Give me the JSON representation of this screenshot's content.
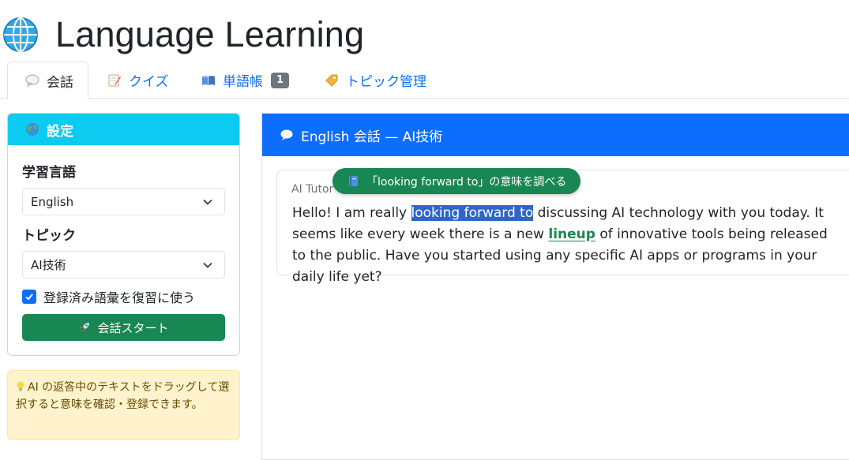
{
  "app": {
    "title": "Language Learning",
    "icon": "globe-icon"
  },
  "tabs": [
    {
      "label": "会話",
      "icon": "speech-bubble-icon",
      "active": true
    },
    {
      "label": "クイズ",
      "icon": "memo-icon",
      "active": false
    },
    {
      "label": "単語帳",
      "icon": "open-book-icon",
      "active": false,
      "badge": "1"
    },
    {
      "label": "トピック管理",
      "icon": "tag-icon",
      "active": false
    }
  ],
  "settings": {
    "header": "設定",
    "language_label": "学習言語",
    "language_value": "English",
    "topic_label": "トピック",
    "topic_value": "AI技術",
    "review_checkbox_label": "登録済み語彙を復習に使う",
    "review_checked": true,
    "start_button": "会話スタート"
  },
  "hint": {
    "text": "AI の返答中のテキストをドラッグして選択すると意味を確認・登録できます。"
  },
  "conversation": {
    "header": "English 会話 — AI技術",
    "message": {
      "sender": "AI Tutor",
      "text_before": "Hello! I am really ",
      "selected": "looking forward to",
      "text_middle": " discussing AI technology with you today. It seems like every week there is a new ",
      "vocab": "lineup",
      "text_after": " of innovative tools being released to the public. Have you started using any specific AI apps or programs in your daily life yet?"
    },
    "lookup_tooltip": "「looking forward to」の意味を調べる"
  },
  "colors": {
    "primary": "#0d6efd",
    "info": "#0dcaf0",
    "success": "#198754",
    "warning_bg": "#fff3cd",
    "selection": "#3065c8"
  }
}
